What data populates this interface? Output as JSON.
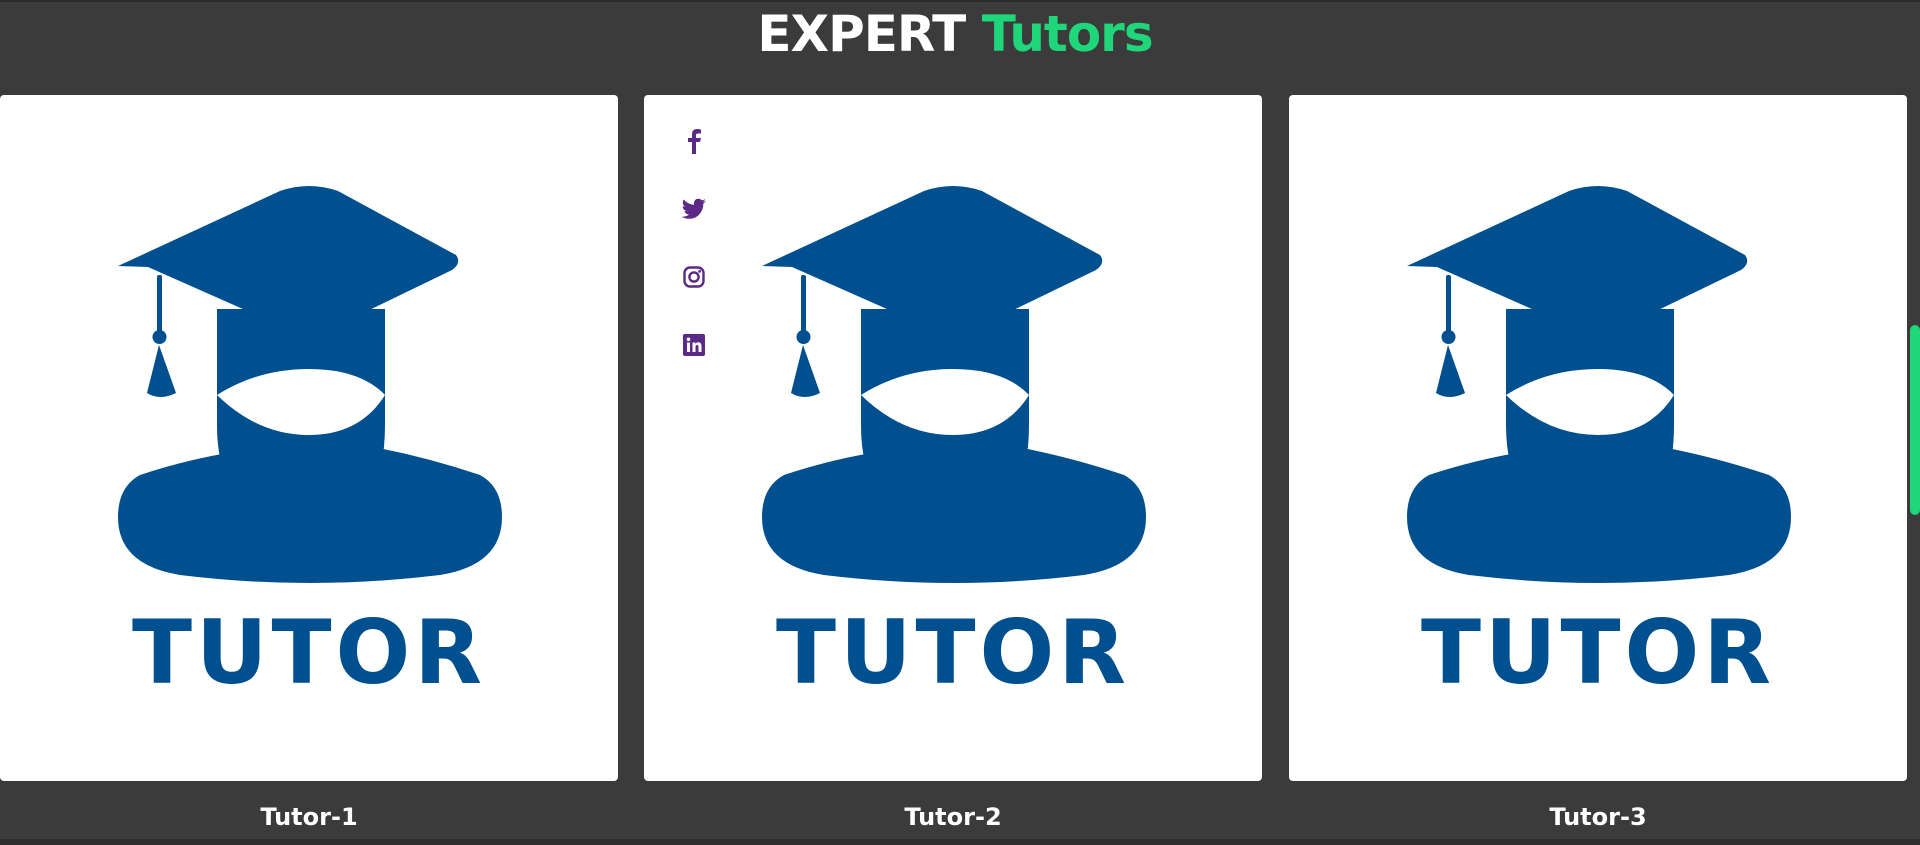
{
  "header": {
    "title_word1": "EXPERT",
    "title_word2": "Tutors",
    "accent_color": "#20d67a"
  },
  "cards": [
    {
      "image_text": "TUTOR",
      "caption": "Tutor-1"
    },
    {
      "image_text": "TUTOR",
      "caption": "Tutor-2"
    },
    {
      "image_text": "TUTOR",
      "caption": "Tutor-3"
    }
  ],
  "social_icons": [
    "facebook-icon",
    "twitter-icon",
    "instagram-icon",
    "linkedin-icon"
  ],
  "colors": {
    "background": "#3b3b3b",
    "card": "#ffffff",
    "tutor_blue": "#004f8f",
    "social_purple": "#5b2a86"
  }
}
